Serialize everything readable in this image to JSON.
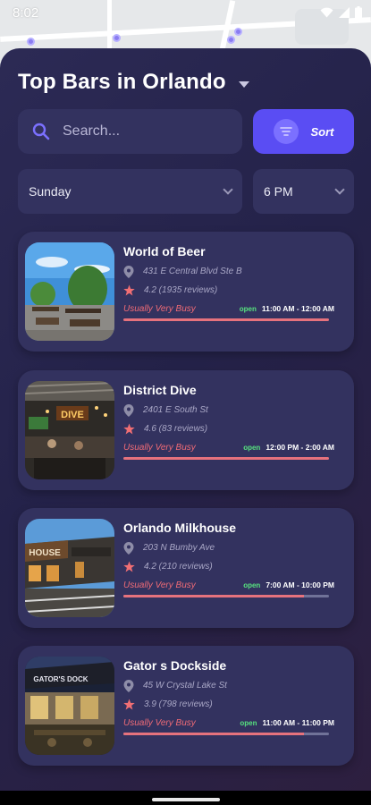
{
  "status": {
    "time": "8:02",
    "icons": [
      "wifi-icon",
      "signal-icon",
      "battery-icon"
    ]
  },
  "header": {
    "title": "Top Bars in Orlando"
  },
  "search": {
    "placeholder": "Search..."
  },
  "sort": {
    "label": "Sort",
    "icon": "filter-icon"
  },
  "filters": {
    "day": "Sunday",
    "time": "6 PM"
  },
  "colors": {
    "accent": "#5a4df3",
    "busy": "#f06b76",
    "open": "#57e37f",
    "star": "#f16f74",
    "card": "#33325f"
  },
  "bars": [
    {
      "name": "World of Beer",
      "address": "431 E Central Blvd Ste B",
      "rating": "4.2 (1935 reviews)",
      "busy": "Usually Very Busy",
      "status": "open",
      "hours": "11:00 AM - 12:00 AM",
      "busyness": 1.0
    },
    {
      "name": "District Dive",
      "address": "2401 E South St",
      "rating": "4.6 (83 reviews)",
      "busy": "Usually Very Busy",
      "status": "open",
      "hours": "12:00 PM - 2:00 AM",
      "busyness": 1.0
    },
    {
      "name": "Orlando Milkhouse",
      "address": "203 N Bumby Ave",
      "rating": "4.2 (210 reviews)",
      "busy": "Usually Very Busy",
      "status": "open",
      "hours": "7:00 AM - 10:00 PM",
      "busyness": 0.88
    },
    {
      "name": "Gator s Dockside",
      "address": "45 W Crystal Lake St",
      "rating": "3.9 (798 reviews)",
      "busy": "Usually Very Busy",
      "status": "open",
      "hours": "11:00 AM - 11:00 PM",
      "busyness": 0.88
    }
  ]
}
